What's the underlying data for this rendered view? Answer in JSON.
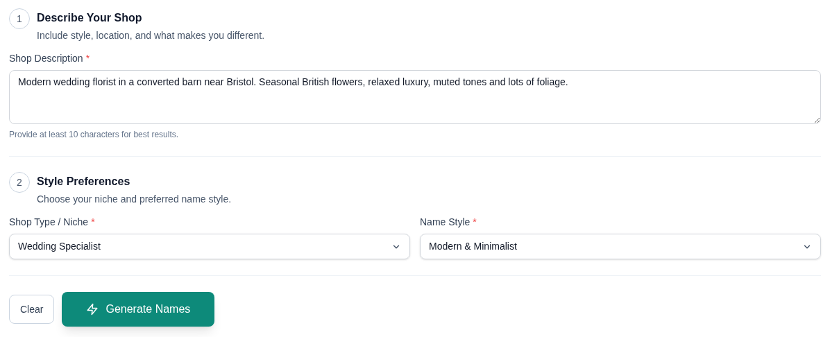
{
  "sections": [
    {
      "number": "1",
      "title": "Describe Your Shop",
      "subtitle": "Include style, location, and what makes you different.",
      "fields": [
        {
          "kind": "textarea",
          "label": "Shop Description",
          "required_mark": "*",
          "value": "Modern wedding florist in a converted barn near Bristol. Seasonal British flowers, relaxed luxury, muted tones and lots of foliage.",
          "hint": "Provide at least 10 characters for best results."
        }
      ]
    },
    {
      "number": "2",
      "title": "Style Preferences",
      "subtitle": "Choose your niche and preferred name style.",
      "fields": [
        {
          "kind": "select",
          "label": "Shop Type / Niche",
          "required_mark": "*",
          "value": "Wedding Specialist"
        },
        {
          "kind": "select",
          "label": "Name Style",
          "required_mark": "*",
          "value": "Modern & Minimalist"
        }
      ]
    }
  ],
  "buttons": [
    {
      "kind": "secondary",
      "label": "Clear"
    },
    {
      "kind": "primary",
      "label": "Generate Names"
    }
  ]
}
